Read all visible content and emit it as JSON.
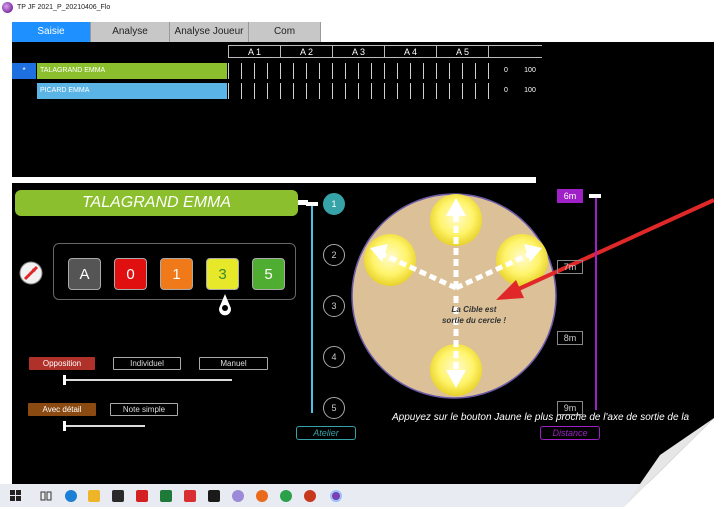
{
  "window": {
    "title": "TP JF 2021_P_20210406_Flo"
  },
  "tabs": [
    {
      "label": "Saisie",
      "active": true
    },
    {
      "label": "Analyse",
      "active": false
    },
    {
      "label": "Analyse Joueur",
      "active": false
    },
    {
      "label": "Com",
      "active": false
    }
  ],
  "table": {
    "columns": [
      "A 1",
      "A 2",
      "A 3",
      "A 4",
      "A 5"
    ],
    "rows": [
      {
        "marker": "*",
        "name": "TALAGRAND  EMMA",
        "value1": "0",
        "value2": "100",
        "color": "#8bbf2d"
      },
      {
        "marker": "",
        "name": "PICARD  EMMA",
        "value1": "0",
        "value2": "100",
        "color": "#5bb4e6"
      }
    ]
  },
  "player": {
    "name": "TALAGRAND  EMMA"
  },
  "score_buttons": [
    {
      "label": "A",
      "color": "#555555"
    },
    {
      "label": "0",
      "color": "#e01010"
    },
    {
      "label": "1",
      "color": "#f07a1a"
    },
    {
      "label": "3",
      "color": "#e8e82a"
    },
    {
      "label": "5",
      "color": "#4fae32"
    }
  ],
  "mode_buttons": {
    "opposition": "Opposition",
    "individuel": "Individuel",
    "manuel": "Manuel"
  },
  "detail_buttons": {
    "avec_detail": "Avec détail",
    "note_simple": "Note simple"
  },
  "atelier": {
    "numbers": [
      "1",
      "2",
      "3",
      "4",
      "5"
    ],
    "selected": "1",
    "label": "Atelier"
  },
  "distance": {
    "labels": [
      "6m",
      "7m",
      "8m",
      "9m"
    ],
    "selected": "6m",
    "label": "Distance"
  },
  "target": {
    "message_line1": "La Cible est",
    "message_line2": "sortie du cercle !"
  },
  "help": {
    "text": "Appuyez sur le bouton Jaune le plus proche de l'axe de sortie de la"
  },
  "colors": {
    "accent_blue": "#1e90ff",
    "green": "#8bbf2d",
    "light_blue": "#5bb4e6",
    "target_sand": "#dcc198",
    "distance_purple": "#a020c8",
    "atelier_teal": "#36a3a8"
  }
}
